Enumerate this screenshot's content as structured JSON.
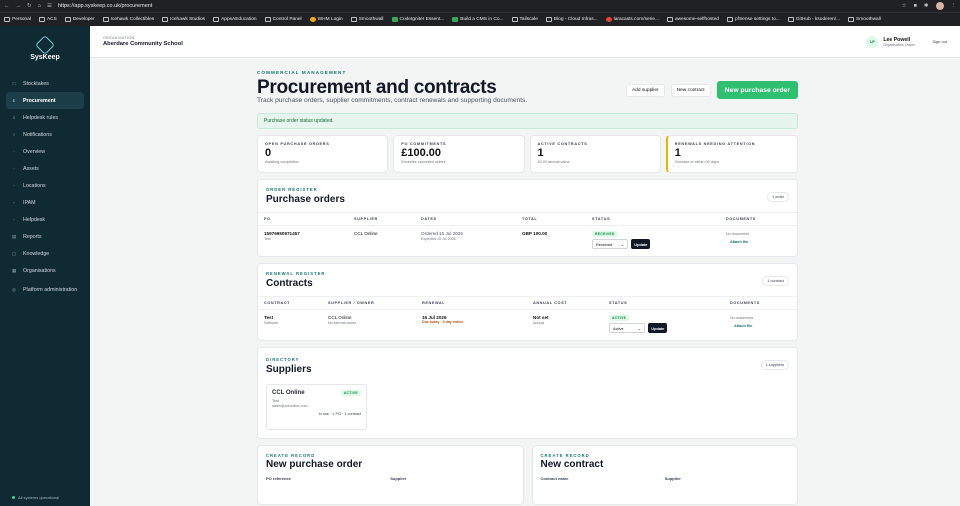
{
  "browser": {
    "url": "https://app.syskeep.co.uk/procurement",
    "bookmarks": [
      "Personal",
      "ACS",
      "Developer",
      "Icehawk Collectibles",
      "Icehawk Studios",
      "AppsAEducation",
      "Control Panel",
      "WHM Login",
      "Smoothwall",
      "CodeIgniter Essent...",
      "Build a CMS in Co...",
      "Tailscale",
      "Blog - Cloud Infras...",
      "laracasts.com/serie...",
      "awesome-selfhosted",
      "pfSense settings to...",
      "GitHub - ksoderen/...",
      "Smoothwall"
    ]
  },
  "sidebar": {
    "brand": "SysKeep",
    "items": [
      {
        "label": "Stocktakes",
        "icon": "stocktake-icon"
      },
      {
        "label": "Procurement",
        "icon": "pound-icon",
        "active": true
      },
      {
        "label": "Helpdesk rules",
        "icon": "rules-icon"
      },
      {
        "label": "Notifications",
        "icon": "bell-icon"
      },
      {
        "label": "Overview",
        "icon": "overview-icon"
      },
      {
        "label": "Assets",
        "icon": "assets-icon"
      },
      {
        "label": "Locations",
        "icon": "location-icon"
      },
      {
        "label": "IPAM",
        "icon": "network-icon"
      },
      {
        "label": "Helpdesk",
        "icon": "helpdesk-icon"
      },
      {
        "label": "Reports",
        "icon": "reports-icon"
      },
      {
        "label": "Knowledge",
        "icon": "knowledge-icon"
      },
      {
        "label": "Organisations",
        "icon": "org-icon"
      },
      {
        "label": "Platform administration",
        "icon": "admin-icon"
      }
    ],
    "status": "All systems operational"
  },
  "topbar": {
    "org_label": "ORGANISATION",
    "org_name": "Aberdare Community School",
    "user_initials": "LP",
    "user_name": "Lee Powell",
    "user_role": "Organisation Owner",
    "sign_out": "Sign out"
  },
  "header": {
    "eyebrow": "COMMERCIAL MANAGEMENT",
    "title": "Procurement and contracts",
    "subtitle": "Track purchase orders, supplier commitments, contract renewals and supporting documents.",
    "add_supplier": "Add supplier",
    "new_contract": "New contract",
    "new_po": "New purchase order"
  },
  "alert": "Purchase order status updated.",
  "stats": [
    {
      "label": "OPEN PURCHASE ORDERS",
      "value": "0",
      "note": "Awaiting completion"
    },
    {
      "label": "PO COMMITMENTS",
      "value": "£100.00",
      "note": "Excludes cancelled orders"
    },
    {
      "label": "ACTIVE CONTRACTS",
      "value": "1",
      "note": "£0.00 annual value"
    },
    {
      "label": "RENEWALS NEEDING ATTENTION",
      "value": "1",
      "note": "Overdue or within 90 days"
    }
  ],
  "orders": {
    "eyebrow": "ORDER REGISTER",
    "title": "Purchase orders",
    "count": "1 order",
    "columns": [
      "PO",
      "SUPPLIER",
      "DATES",
      "TOTAL",
      "STATUS",
      "DOCUMENTS"
    ],
    "row": {
      "po": "15976950971457",
      "po_sub": "Test",
      "supplier": "CCL Online",
      "ordered": "Ordered 15 Jul 2026",
      "expected": "Expected 15 Jul 2026",
      "total": "GBP 100.00",
      "status": "RECEIVED",
      "select": "Received",
      "update": "Update",
      "docs": "No documents",
      "attach": "Attach file"
    }
  },
  "contracts": {
    "eyebrow": "RENEWAL REGISTER",
    "title": "Contracts",
    "count": "1 contract",
    "columns": [
      "CONTRACT",
      "SUPPLIER / OWNER",
      "RENEWAL",
      "ANNUAL COST",
      "STATUS",
      "DOCUMENTS"
    ],
    "row": {
      "name": "Test",
      "type": "Software",
      "supplier": "CCL Online",
      "owner": "No internal owner",
      "renewal": "16 Jul 2026",
      "renewal_note": "Due today · 0 day notice",
      "cost": "Not set",
      "cost_note": "Annual",
      "status": "ACTIVE",
      "select": "Active",
      "update": "Update",
      "docs": "No documents",
      "attach": "Attach file"
    }
  },
  "suppliers": {
    "eyebrow": "DIRECTORY",
    "title": "Suppliers",
    "count": "1 suppliers",
    "card": {
      "name": "CCL Online",
      "status": "ACTIVE",
      "contact": "Test",
      "email": "sales@cclonline.com",
      "usage": "In use · 1 PO · 1 contract"
    }
  },
  "forms": {
    "po": {
      "eyebrow": "CREATE RECORD",
      "title": "New purchase order",
      "f1": "PO reference",
      "f2": "Supplier"
    },
    "contract": {
      "eyebrow": "CREATE RECORD",
      "title": "New contract",
      "f1": "Contract name",
      "f2": "Supplier"
    }
  }
}
